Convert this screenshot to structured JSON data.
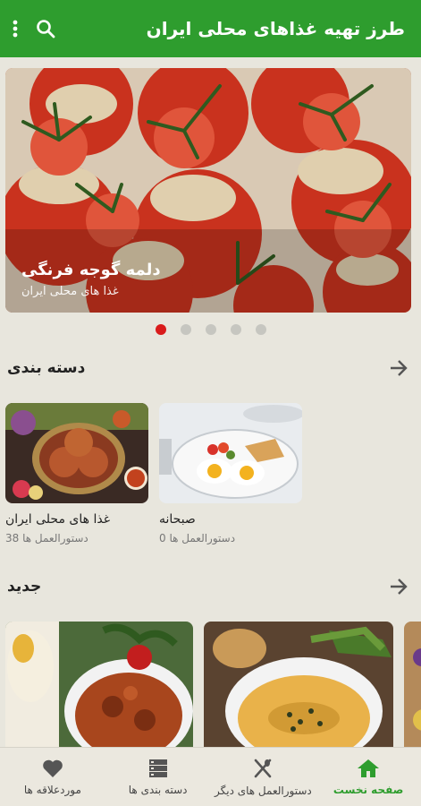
{
  "appbar": {
    "title": "طرز تهیه غذاهای محلی ایران",
    "search_icon": "search-icon",
    "menu_icon": "more-vert-icon"
  },
  "hero": {
    "title": "دلمه گوجه فرنگی",
    "subtitle": "غذا های محلی ایران",
    "pages": 5,
    "active_page": 1
  },
  "categories": {
    "label": "دسته بندی",
    "items": [
      {
        "name": "غذا های محلی ایران",
        "count": "38 دستورالعمل ها"
      },
      {
        "name": "صبحانه",
        "count": "0 دستورالعمل ها"
      }
    ]
  },
  "new_section": {
    "label": "جدید"
  },
  "bottom_nav": [
    {
      "label": "صفحه نخست",
      "icon": "home-icon",
      "active": true
    },
    {
      "label": "دستورالعمل های دیگر",
      "icon": "fork-knife-icon",
      "active": false
    },
    {
      "label": "دسته بندی ها",
      "icon": "category-list-icon",
      "active": false
    },
    {
      "label": "موردعلاقه ها",
      "icon": "heart-icon",
      "active": false
    }
  ],
  "colors": {
    "primary": "#2e9d2e",
    "dot_active": "#d91b1b",
    "background": "#e8e6dd"
  }
}
